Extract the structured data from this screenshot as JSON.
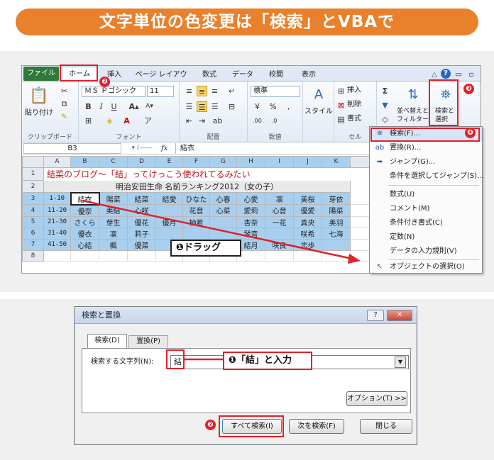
{
  "banner": {
    "title": "文字単位の色変更は「検索」とVBAで"
  },
  "excel": {
    "tabs": [
      "ファイル",
      "ホーム",
      "挿入",
      "ページ レイアウト",
      "数式",
      "データ",
      "校閲",
      "表示"
    ],
    "ribbon": {
      "clipboard": {
        "paste_label": "貼り付け",
        "group_label": "クリップボード"
      },
      "font": {
        "font_name": "ＭＳ Ｐゴシック",
        "font_size": "11",
        "group_label": "フォント",
        "bold": "B",
        "italic": "I",
        "underline": "U"
      },
      "alignment": {
        "group_label": "配置"
      },
      "number": {
        "format": "標準",
        "group_label": "数値"
      },
      "styles": {
        "label": "スタイル"
      },
      "cells": {
        "insert": "挿入",
        "delete": "削除",
        "format": "書式",
        "group_label": "セル"
      },
      "editing": {
        "sort_line1": "並べ替えと",
        "sort_line2": "フィルター",
        "find_line1": "検索と",
        "find_line2": "選択"
      }
    },
    "name_box": "B3",
    "formula": "結衣",
    "fx": "fx",
    "col_headers": [
      "A",
      "B",
      "C",
      "D",
      "E",
      "F",
      "G",
      "H",
      "I",
      "J",
      "K"
    ],
    "row_numbers": [
      "1",
      "2",
      "3",
      "4",
      "5",
      "6",
      "7",
      "8"
    ],
    "sheet_title": "結菜のブログ〜「結」ってけっこう使われてるみたい",
    "table_title": "明治安田生命 名前ランキング2012（女の子）",
    "rows": [
      {
        "label": "1-10",
        "names": [
          "結衣",
          "陽菜",
          "結菜",
          "結愛",
          "ひなた",
          "心春",
          "心愛",
          "凛",
          "美桜",
          "芽依"
        ]
      },
      {
        "label": "11-20",
        "names": [
          "優奈",
          "美結",
          "心咲",
          "",
          "花音",
          "心菜",
          "愛莉",
          "心音",
          "優愛",
          "陽菜"
        ]
      },
      {
        "label": "21-30",
        "names": [
          "さくら",
          "芽生",
          "優花",
          "優月",
          "柚希",
          "",
          "杏奈",
          "一花",
          "真央",
          "美羽"
        ]
      },
      {
        "label": "31-40",
        "names": [
          "優衣",
          "凛",
          "莉子",
          "",
          "",
          "",
          "琴音",
          "",
          "咲希",
          "七海"
        ]
      },
      {
        "label": "41-50",
        "names": [
          "心結",
          "楓",
          "優菜",
          "",
          "",
          "",
          "結月",
          "咲良",
          "志歩",
          ""
        ]
      }
    ],
    "menu": [
      {
        "icon": "binoculars-icon",
        "label": "検索(F)..."
      },
      {
        "icon": "replace-icon",
        "label": "置換(R)..."
      },
      {
        "icon": "arrow-right-icon",
        "label": "ジャンプ(G)..."
      },
      {
        "icon": "",
        "label": "条件を選択してジャンプ(S)..."
      },
      {
        "icon": "",
        "label": "数式(U)"
      },
      {
        "icon": "",
        "label": "コメント(M)"
      },
      {
        "icon": "",
        "label": "条件付き書式(C)"
      },
      {
        "icon": "",
        "label": "定数(N)"
      },
      {
        "icon": "",
        "label": "データの入力規則(V)"
      },
      {
        "icon": "cursor-icon",
        "label": "オブジェクトの選択(O)"
      }
    ]
  },
  "callouts": {
    "drag": "❶ドラッグ",
    "enter": "❶「結」と入力"
  },
  "badges": {
    "b1": "❷",
    "b2": "❸",
    "b3": "❹",
    "b4": "❷"
  },
  "dialog": {
    "title": "検索と置換",
    "help": "?",
    "tab_find": "検索(D)",
    "tab_replace": "置換(P)",
    "search_label": "検索する文字列(N):",
    "search_value": "結",
    "options_button": "オプション(T) >>",
    "find_all": "すべて検索(I)",
    "find_next": "次を検索(F)",
    "close": "閉じる"
  },
  "colors": {
    "accent": "#e9802c",
    "highlight_red": "#e2202a",
    "selection_blue": "#a9cfee"
  }
}
